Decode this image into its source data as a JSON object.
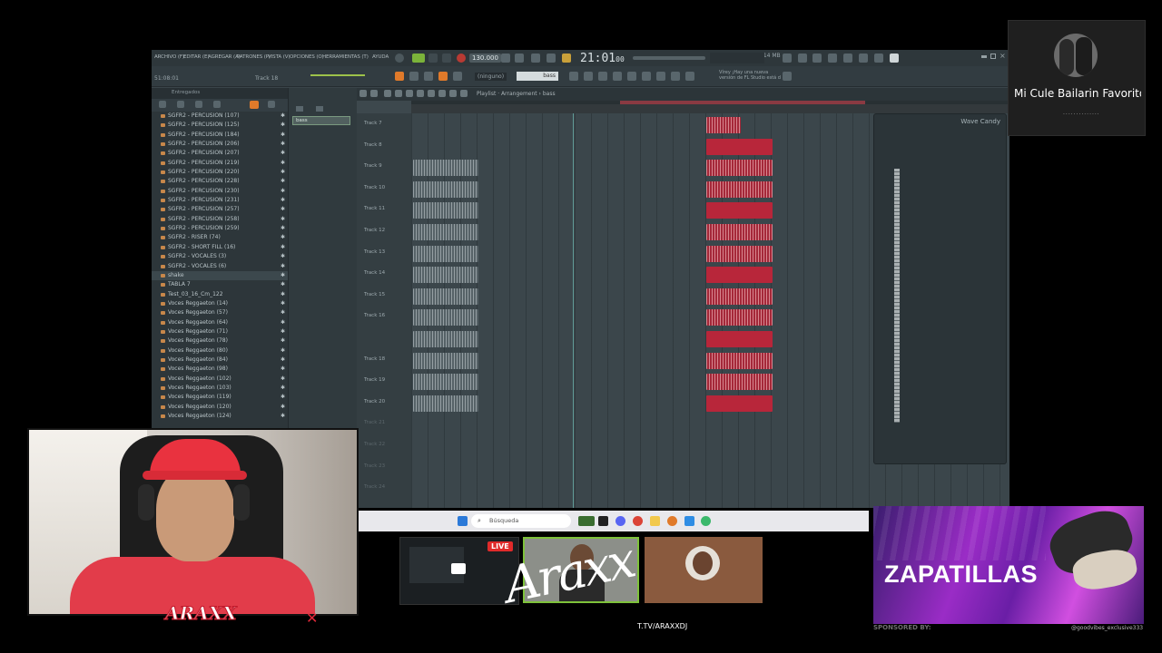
{
  "fl_studio": {
    "menu": [
      "ARCHIVO (F)",
      "EDITAR (E)",
      "AGREGAR (A)",
      "PATRONES (P)",
      "VISTA (V)",
      "OPCIONES (O)",
      "HERRAMIENTAS (T)",
      "AYUDA"
    ],
    "position_readout": "51:08:01",
    "track_label": "Track 18",
    "tempo": "130.000",
    "time": "21:01",
    "time_sub": "00",
    "pattern_select": "(ninguno)",
    "channel_name": "bass",
    "hint_text": "Vírey ¡Hay una nueva versión de FL Studio está d",
    "memory": "914 MB",
    "browser_header": "Entregados",
    "browser_items": [
      "SGFR2 - PERCUSION (107)",
      "SGFR2 - PERCUSION (125)",
      "SGFR2 - PERCUSION (184)",
      "SGFR2 - PERCUSION (206)",
      "SGFR2 - PERCUSION (207)",
      "SGFR2 - PERCUSION (219)",
      "SGFR2 - PERCUSION (220)",
      "SGFR2 - PERCUSION (228)",
      "SGFR2 - PERCUSION (230)",
      "SGFR2 - PERCUSION (231)",
      "SGFR2 - PERCUSION (257)",
      "SGFR2 - PERCUSION (258)",
      "SGFR2 - PERCUSION (259)",
      "SGFR2 - RISER (74)",
      "SGFR2 - SHORT FILL (16)",
      "SGFR2 - VOCALES (3)",
      "SGFR2 - VOCALES (6)",
      "shake",
      "TABLA 7",
      "Test_03_16_Cm_122",
      "Voces Reggaeton (14)",
      "Voces Reggaeton (57)",
      "Voces Reggaeton (64)",
      "Voces Reggaeton (71)",
      "Voces Reggaeton (78)",
      "Voces Reggaeton (80)",
      "Voces Reggaeton (84)",
      "Voces Reggaeton (98)",
      "Voces Reggaeton (102)",
      "Voces Reggaeton (103)",
      "Voces Reggaeton (119)",
      "Voces Reggaeton (120)",
      "Voces Reggaeton (124)"
    ],
    "playlist_breadcrumb": "Playlist · Arrangement › bass",
    "tracks": [
      "Track 7",
      "Track 8",
      "Track 9",
      "Track 10",
      "Track 11",
      "Track 12",
      "Track 13",
      "Track 14",
      "Track 15",
      "Track 16",
      "",
      "Track 18",
      "Track 19",
      "Track 20",
      "Track 21",
      "Track 22",
      "Track 23",
      "Track 24"
    ],
    "wave_candy_title": "Wave Candy"
  },
  "taskbar": {
    "search_placeholder": "Búsqueda"
  },
  "overlay": {
    "live_badge": "LIVE",
    "brand_logo": "Araxx",
    "twitch": "T.TV/ARAXXDJ",
    "cam_logo": "ARAXX",
    "now_playing_title": "Mi Cule Bailarin Favorito",
    "sponsor_word": "ZAPATILLAS",
    "sponsored_by": "SPONSORED BY:",
    "sponsor_handle": "@goodvibes_exclusive333"
  },
  "colors": {
    "fl_bg": "#3a4449",
    "clip_red": "#b8263a",
    "live_red": "#e02a2a",
    "sponsor_purple": "#9a2cc6"
  }
}
